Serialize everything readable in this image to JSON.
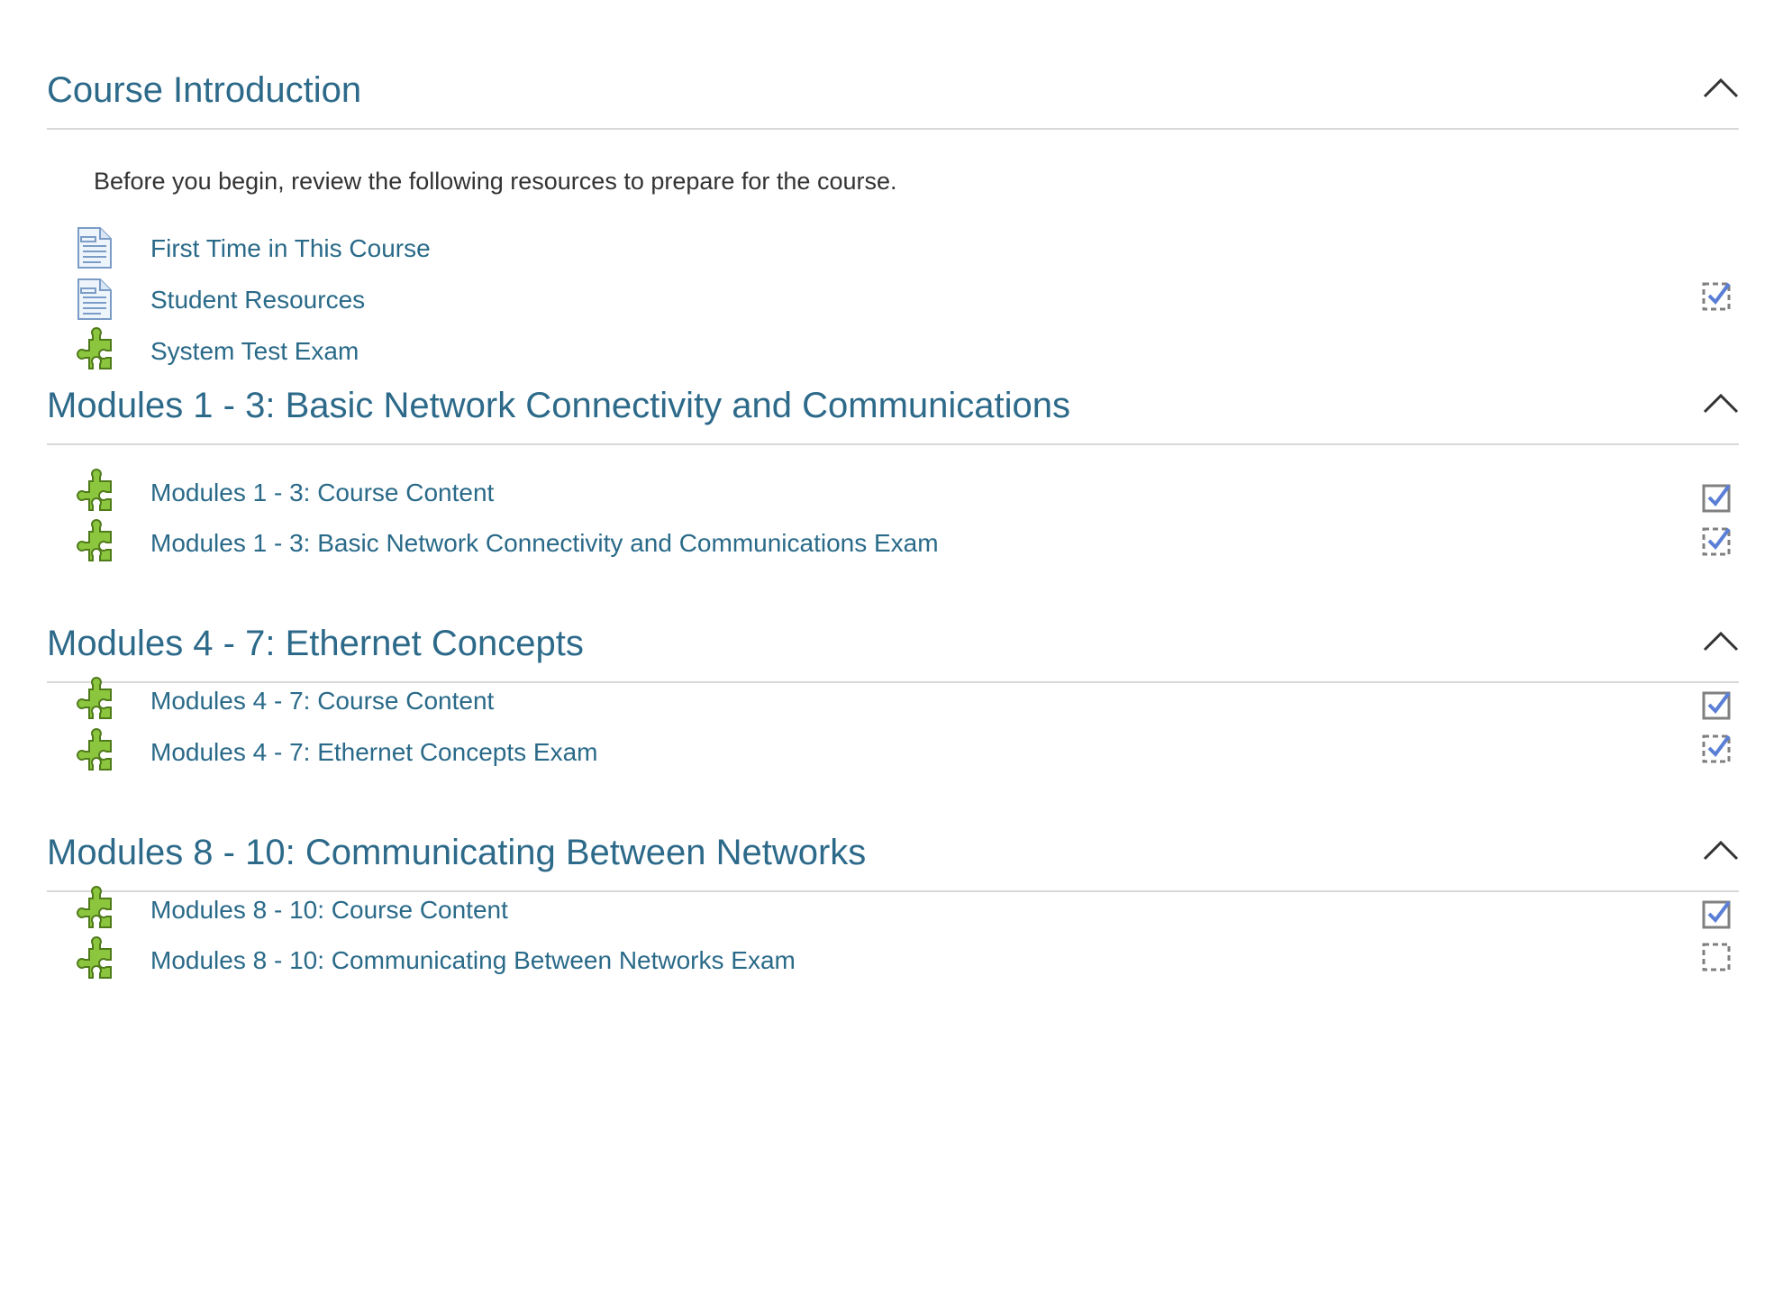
{
  "sections": [
    {
      "title": "Course Introduction",
      "toggle_icon": "chevron-up-icon",
      "summary": "Before you begin, review the following resources to prepare for the course.",
      "activities": [
        {
          "label": "First Time in This Course",
          "type": "page",
          "icon": "page-document-icon",
          "completion": "none"
        },
        {
          "label": "Student Resources",
          "type": "page",
          "icon": "page-document-icon",
          "completion": "none"
        },
        {
          "label": "System Test Exam",
          "type": "scorm",
          "icon": "scorm-puzzle-icon",
          "completion": "auto-complete"
        }
      ]
    },
    {
      "title": "Modules 1 - 3: Basic Network Connectivity and Communications",
      "toggle_icon": "chevron-up-icon",
      "activities": [
        {
          "label": "Modules 1 - 3: Course Content",
          "type": "scorm",
          "icon": "scorm-puzzle-icon",
          "completion": "manual-complete"
        },
        {
          "label": "Modules 1 - 3: Basic Network Connectivity and Communications Exam",
          "type": "scorm",
          "icon": "scorm-puzzle-icon",
          "completion": "auto-complete"
        }
      ]
    },
    {
      "title": "Modules 4 - 7: Ethernet Concepts",
      "toggle_icon": "chevron-up-icon",
      "activities": [
        {
          "label": "Modules 4 - 7: Course Content",
          "type": "scorm",
          "icon": "scorm-puzzle-icon",
          "completion": "manual-complete"
        },
        {
          "label": "Modules 4 - 7: Ethernet Concepts Exam",
          "type": "scorm",
          "icon": "scorm-puzzle-icon",
          "completion": "auto-complete"
        }
      ]
    },
    {
      "title": "Modules 8 - 10: Communicating Between Networks",
      "toggle_icon": "chevron-up-icon",
      "activities": [
        {
          "label": "Modules 8 - 10: Course Content",
          "type": "scorm",
          "icon": "scorm-puzzle-icon",
          "completion": "manual-complete"
        },
        {
          "label": "Modules 8 - 10: Communicating Between Networks Exam",
          "type": "scorm",
          "icon": "scorm-puzzle-icon",
          "completion": "auto-incomplete"
        }
      ]
    }
  ],
  "colors": {
    "heading": "#2d6a8a",
    "link": "#2a6a89",
    "text": "#333333",
    "divider": "#d9d9d9",
    "check": "#5b7fd6",
    "box": "#808080",
    "puzzle_green": "#8cc63f"
  }
}
